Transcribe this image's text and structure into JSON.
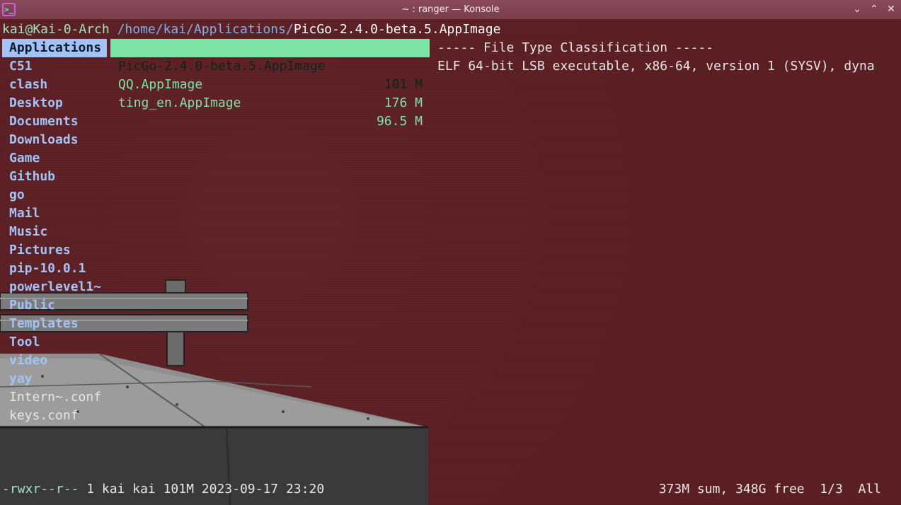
{
  "window": {
    "title": "~ : ranger — Konsole",
    "app_icon": "terminal-icon",
    "buttons": {
      "minimize": "⌄",
      "maximize": "⌃",
      "close": "✕"
    }
  },
  "header": {
    "host": "kai@Kai-0-Arch",
    "path": "/home/kai/Applications/",
    "current_file": "PicGo-2.4.0-beta.5.AppImage"
  },
  "left_column": [
    {
      "name": "Applications",
      "type": "dir",
      "selected": true
    },
    {
      "name": "C51",
      "type": "dir"
    },
    {
      "name": "clash",
      "type": "dir"
    },
    {
      "name": "Desktop",
      "type": "dir"
    },
    {
      "name": "Documents",
      "type": "dir"
    },
    {
      "name": "Downloads",
      "type": "dir"
    },
    {
      "name": "Game",
      "type": "dir"
    },
    {
      "name": "Github",
      "type": "dir"
    },
    {
      "name": "go",
      "type": "dir"
    },
    {
      "name": "Mail",
      "type": "dir"
    },
    {
      "name": "Music",
      "type": "dir"
    },
    {
      "name": "Pictures",
      "type": "dir"
    },
    {
      "name": "pip-10.0.1",
      "type": "dir"
    },
    {
      "name": "powerlevel1~",
      "type": "dir"
    },
    {
      "name": "Public",
      "type": "dir"
    },
    {
      "name": "Templates",
      "type": "dir"
    },
    {
      "name": "Tool",
      "type": "dir"
    },
    {
      "name": "video",
      "type": "dir"
    },
    {
      "name": "yay",
      "type": "dir"
    },
    {
      "name": "Intern~.conf",
      "type": "file"
    },
    {
      "name": "keys.conf",
      "type": "file"
    }
  ],
  "middle_column": [
    {
      "name": "PicGo-2.4.0-beta.5.AppImage",
      "size": "101 M",
      "selected": true
    },
    {
      "name": "QQ.AppImage",
      "size": "176 M"
    },
    {
      "name": "ting_en.AppImage",
      "size": "96.5 M"
    }
  ],
  "preview": {
    "heading": "----- File Type Classification -----",
    "text": "ELF 64-bit LSB executable, x86-64, version 1 (SYSV), dyna"
  },
  "status": {
    "permissions": "-rwxr--r--",
    "info": " 1 kai kai 101M 2023-09-17 23:20",
    "summary": "373M sum, 348G free  1/3  All"
  },
  "colors": {
    "background": "#5c1f24",
    "dir": "#a3c3f7",
    "executable": "#7ee3a6"
  }
}
